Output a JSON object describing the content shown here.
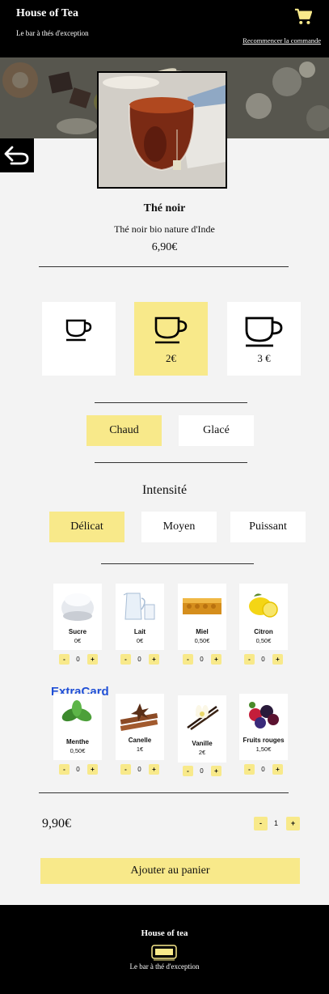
{
  "header": {
    "brand": "House of Tea",
    "tagline": "Le bar à thés d'exception",
    "restart_label": "Recommencer la commande"
  },
  "product": {
    "name": "Thé noir",
    "description": "Thé noir bio nature d'Inde",
    "price": "6,90€"
  },
  "sizes": [
    {
      "id": "small",
      "price": ""
    },
    {
      "id": "medium",
      "price": "2€"
    },
    {
      "id": "large",
      "price": "3 €"
    }
  ],
  "temperature": {
    "options": [
      "Chaud",
      "Glacé"
    ],
    "selected": "Chaud"
  },
  "intensity": {
    "title": "Intensité",
    "options": [
      "Délicat",
      "Moyen",
      "Puissant"
    ],
    "selected": "Délicat"
  },
  "extras_row1": [
    {
      "name": "Sucre",
      "price": "0€",
      "qty": "0"
    },
    {
      "name": "Lait",
      "price": "0€",
      "qty": "0"
    },
    {
      "name": "Miel",
      "price": "0,50€",
      "qty": "0"
    },
    {
      "name": "Citron",
      "price": "0,50€",
      "qty": "0"
    }
  ],
  "extra_card_label": "ExtraCard",
  "extras_row2": [
    {
      "name": "Menthe",
      "price": "0,50€",
      "qty": "0"
    },
    {
      "name": "Canelle",
      "price": "1€",
      "qty": "0"
    },
    {
      "name": "Vanille",
      "price": "2€",
      "qty": "0"
    },
    {
      "name": "Fruits rouges",
      "price": "1,50€",
      "qty": "0"
    }
  ],
  "stepper": {
    "minus": "-",
    "plus": "+"
  },
  "order": {
    "total": "9,90€",
    "quantity": "1",
    "add_label": "Ajouter au panier"
  },
  "footer": {
    "brand": "House of tea",
    "tagline": "Le bar à thé d'exception"
  },
  "colors": {
    "accent": "#f8e98a",
    "dark": "#000000",
    "background": "#f3f3f3",
    "extracard": "#1f4fd6"
  },
  "icons": [
    "cart-icon",
    "back-arrow-icon",
    "cup-icon",
    "logo-icon"
  ]
}
